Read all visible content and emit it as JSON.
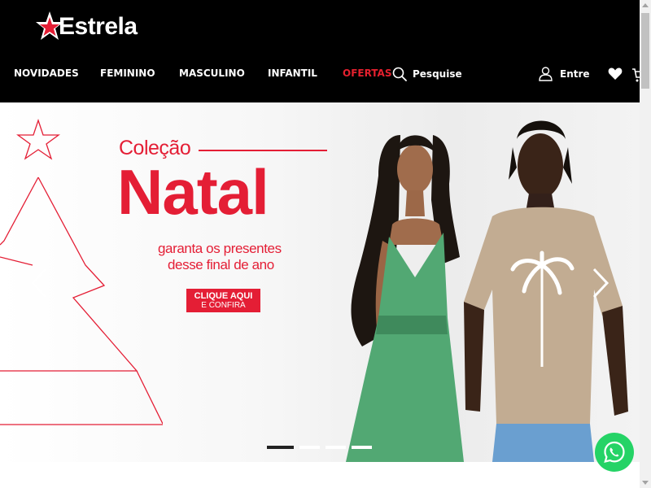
{
  "brand": {
    "name": "Estrela",
    "logo_icon": "star-icon",
    "logo_star_color": "#e41e35"
  },
  "nav": {
    "items": [
      {
        "label": "NOVIDADES"
      },
      {
        "label": "FEMININO"
      },
      {
        "label": "MASCULINO"
      },
      {
        "label": "INFANTIL"
      },
      {
        "label": "OFERTAS"
      }
    ],
    "offer_color": "#e5202e"
  },
  "search": {
    "label": "Pesquise",
    "icon": "search-icon"
  },
  "account": {
    "label": "Entre",
    "icon": "user-icon"
  },
  "wishlist": {
    "icon": "heart-icon"
  },
  "cart": {
    "icon": "cart-icon"
  },
  "banner": {
    "kicker": "Coleção",
    "title": "Natal",
    "subtitle_line1": "garanta os presentes",
    "subtitle_line2": "desse final de ano",
    "cta_line1": "CLIQUE AQUI",
    "cta_line2": "E CONFIRA",
    "accent_color": "#e41e35",
    "slides": 4,
    "active_slide": 1
  },
  "whatsapp": {
    "icon": "whatsapp-icon",
    "color": "#25d366"
  }
}
